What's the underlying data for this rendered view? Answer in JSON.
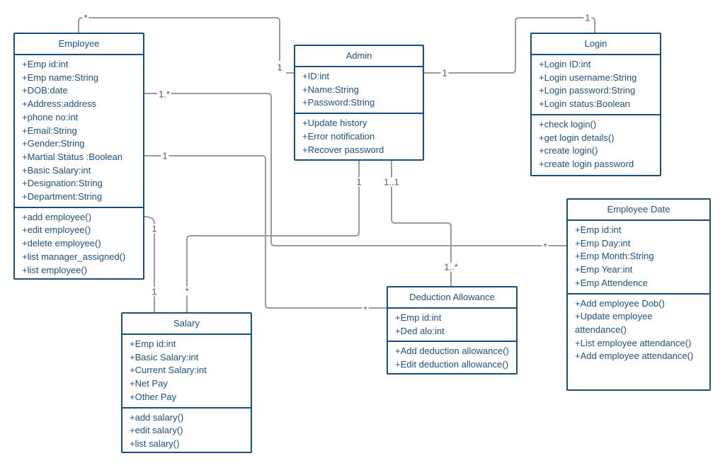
{
  "classes": {
    "employee": {
      "name": "Employee",
      "attributes": [
        "+Emp id:int",
        "+Emp name:String",
        "+DOB:date",
        "+Address:address",
        "+phone no:int",
        "+Email:String",
        "+Gender:String",
        "+Martial Status :Boolean",
        "+Basic Salary:int",
        "+Designation:String",
        "+Department:String"
      ],
      "methods": [
        "+add employee()",
        "+edit employee()",
        "+delete employee()",
        "+list manager_assigned()",
        "+list employee()"
      ]
    },
    "admin": {
      "name": "Admin",
      "attributes": [
        "+ID:int",
        "+Name:String",
        "+Password:String"
      ],
      "methods": [
        "+Update history",
        "+Error notification",
        "+Recover password"
      ]
    },
    "login": {
      "name": "Login",
      "attributes": [
        "+Login ID:int",
        "+Login username:String",
        "+Login password:String",
        "+Login status:Boolean"
      ],
      "methods": [
        "+check login()",
        "+get login details()",
        "+create login()",
        "+create login password"
      ]
    },
    "employee_date": {
      "name": "Employee Date",
      "attributes": [
        "+Emp id:int",
        "+Emp Day:int",
        "+Emp Month:String",
        "+Emp Year:int",
        "+Emp Attendence"
      ],
      "methods": [
        "+Add employee Dob()",
        "+Update employee attendance()",
        "+List employee attendance()",
        "+Add employee attendance()"
      ]
    },
    "deduction": {
      "name": "Deduction Allowance",
      "attributes": [
        "+Emp id:int",
        "+Ded alo:int"
      ],
      "methods": [
        "+Add deduction allowance()",
        "+Edit deduction allowance()"
      ]
    },
    "salary": {
      "name": "Salary",
      "attributes": [
        "+Emp id:int",
        "+Basic Salary:int",
        "+Current Salary:int",
        "+Net Pay",
        "+Other Pay"
      ],
      "methods": [
        "+add salary()",
        "+edit salary()",
        "+list salary()"
      ]
    }
  },
  "associations": [
    {
      "from": "Employee",
      "to": "Admin",
      "from_mult": "*",
      "to_mult": "1"
    },
    {
      "from": "Admin",
      "to": "Login",
      "from_mult": "1",
      "to_mult": "1"
    },
    {
      "from": "Employee",
      "to": "Employee Date",
      "from_mult": "1.*",
      "to_mult": "*"
    },
    {
      "from": "Employee",
      "to": "Deduction Allowance",
      "from_mult": "1",
      "to_mult": "*"
    },
    {
      "from": "Employee",
      "to": "Salary",
      "from_mult": "1",
      "to_mult": "1"
    },
    {
      "from": "Admin",
      "to": "Salary",
      "from_mult": "1",
      "to_mult": "*"
    },
    {
      "from": "Admin",
      "to": "Deduction Allowance",
      "from_mult": "1..1",
      "to_mult": "1..*"
    }
  ],
  "colors": {
    "border": "#1b4e78",
    "text": "#1d4f7c",
    "connector": "#9a9a9a"
  }
}
